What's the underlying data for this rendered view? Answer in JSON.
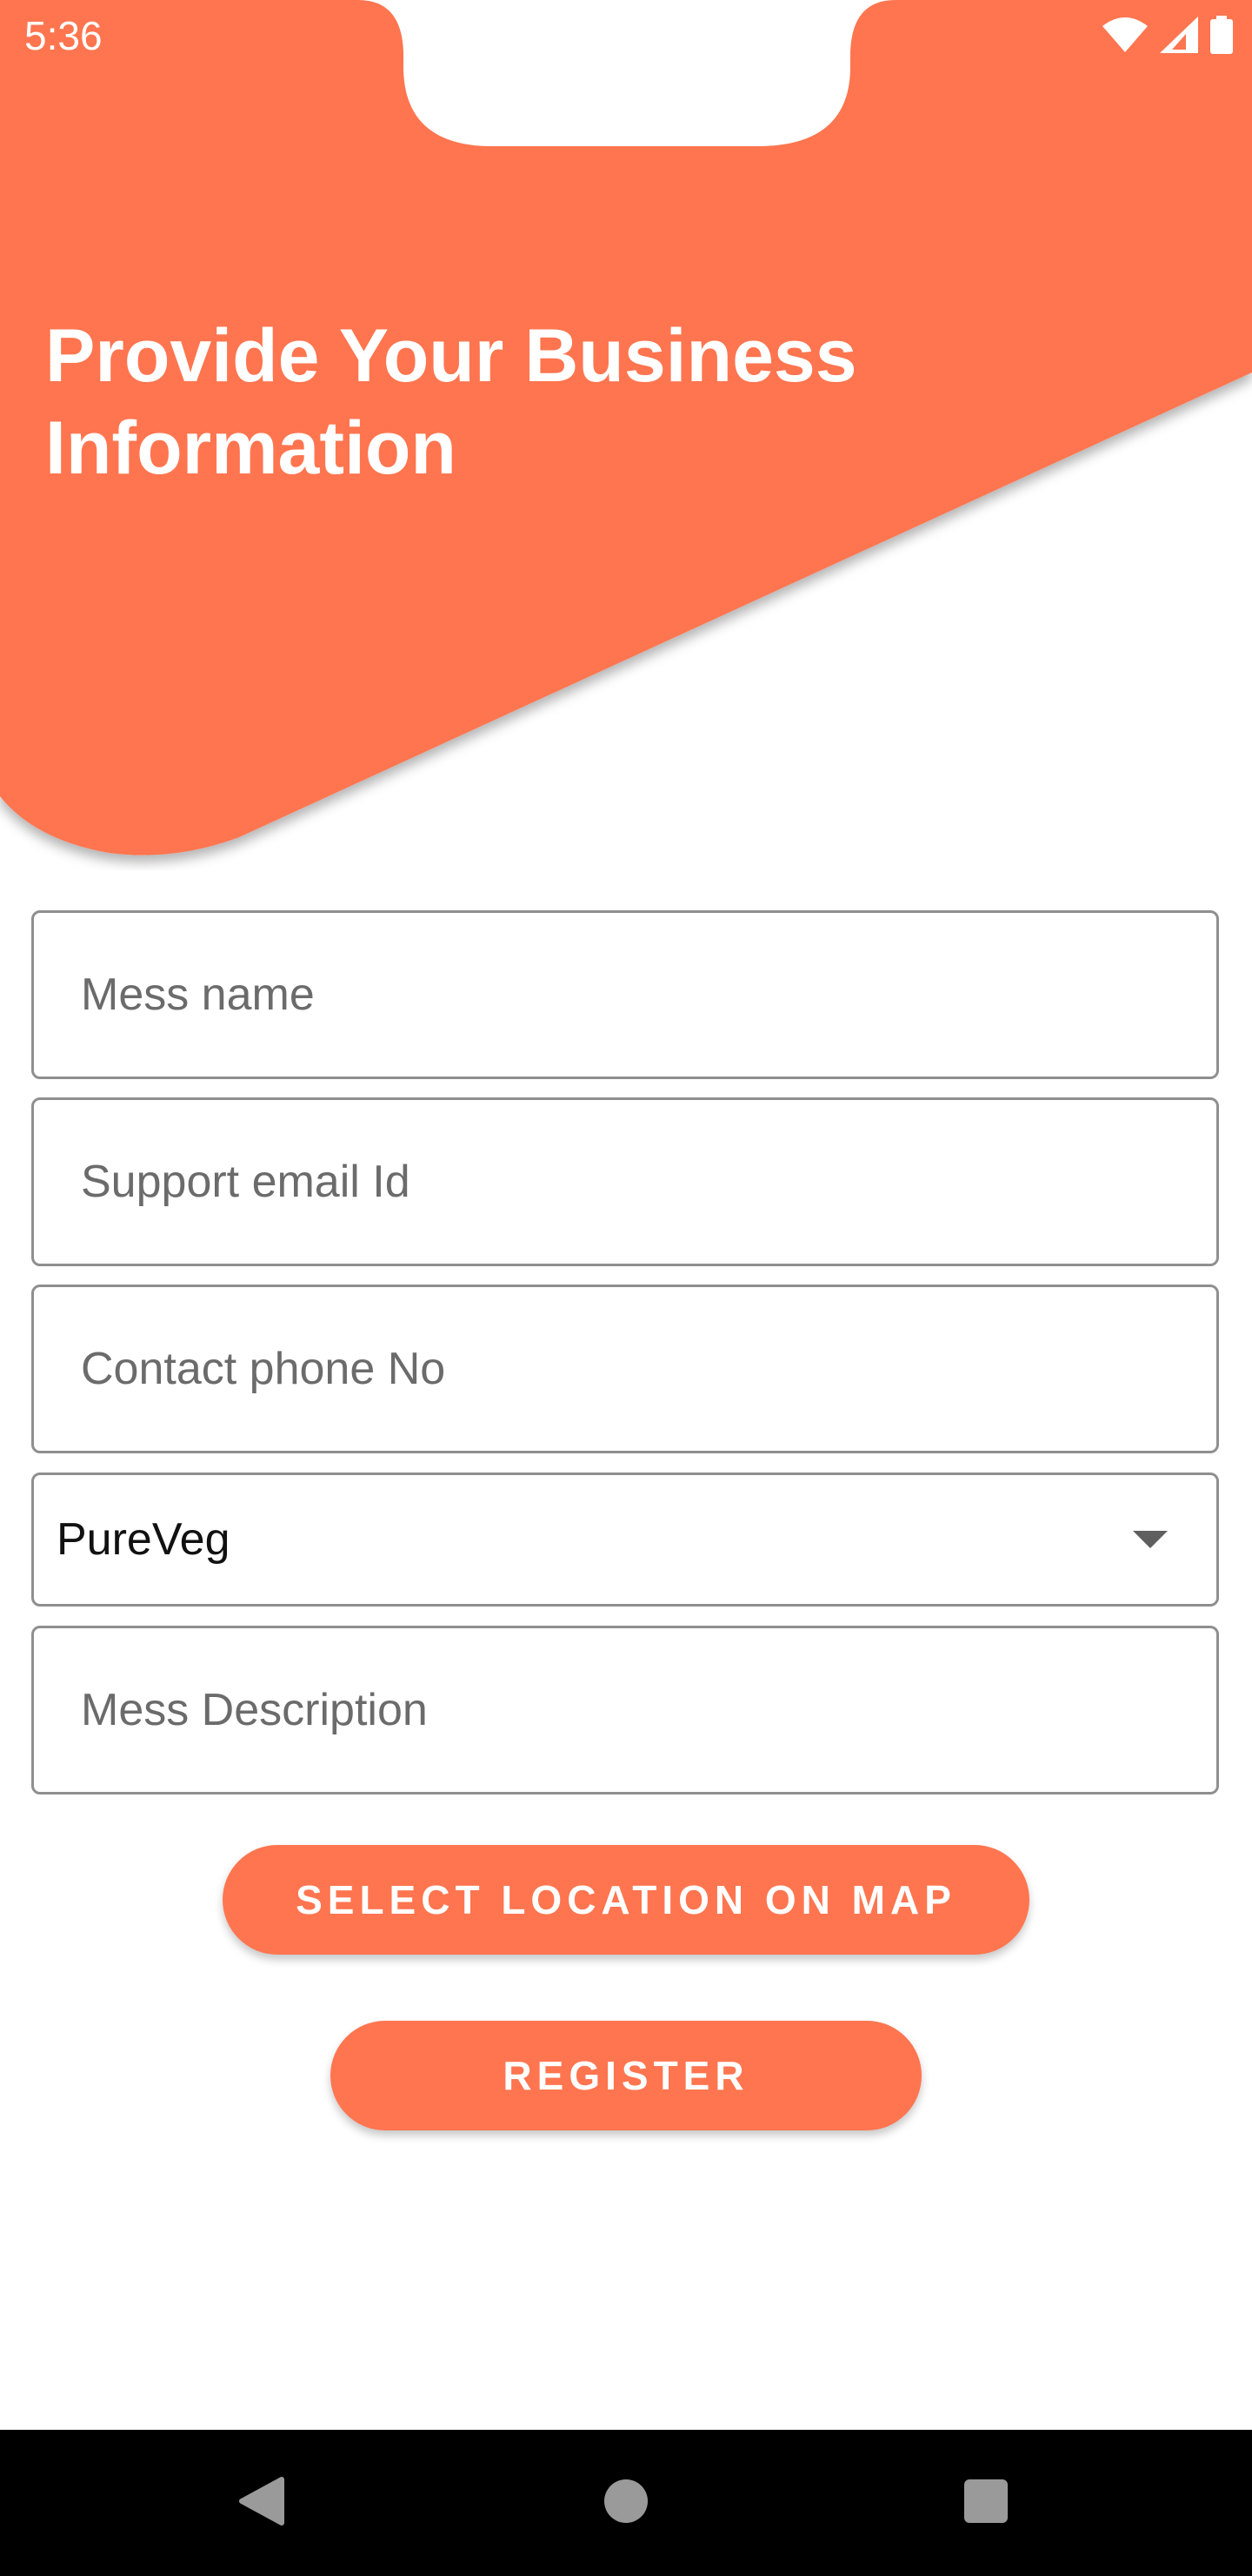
{
  "status_bar": {
    "time": "5:36",
    "icons": [
      "wifi-icon",
      "signal-icon",
      "battery-icon"
    ]
  },
  "header": {
    "title": "Provide Your Business Information",
    "background_color": "#ff7550"
  },
  "form": {
    "mess_name": {
      "placeholder": "Mess name",
      "value": ""
    },
    "support_email": {
      "placeholder": "Support email Id",
      "value": ""
    },
    "contact_phone": {
      "placeholder": "Contact phone No",
      "value": ""
    },
    "food_type": {
      "selected": "PureVeg"
    },
    "mess_description": {
      "placeholder": "Mess Description",
      "value": ""
    }
  },
  "buttons": {
    "select_location": "SELECT LOCATION ON MAP",
    "register": "REGISTER"
  },
  "nav_bar": {
    "icons": [
      "back-icon",
      "home-icon",
      "recents-icon"
    ]
  },
  "colors": {
    "accent": "#ff7550",
    "field_border": "#8f8f8f",
    "nav_bar": "#000000"
  }
}
